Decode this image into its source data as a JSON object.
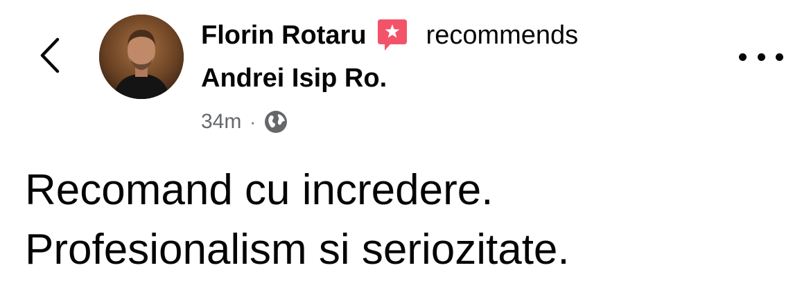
{
  "post": {
    "author": "Florin Rotaru",
    "action": "recommends",
    "page_name": "Andrei Isip Ro.",
    "time": "34m",
    "separator": "·",
    "body_lines": [
      "Recomand cu incredere.",
      "Profesionalism si seriozitate."
    ]
  },
  "icons": {
    "back": "chevron-left-icon",
    "badge": "recommend-badge-icon",
    "audience": "globe-icon",
    "more": "more-horizontal-icon"
  },
  "colors": {
    "badge": "#f35369",
    "meta_text": "#65676b",
    "text": "#050505"
  }
}
